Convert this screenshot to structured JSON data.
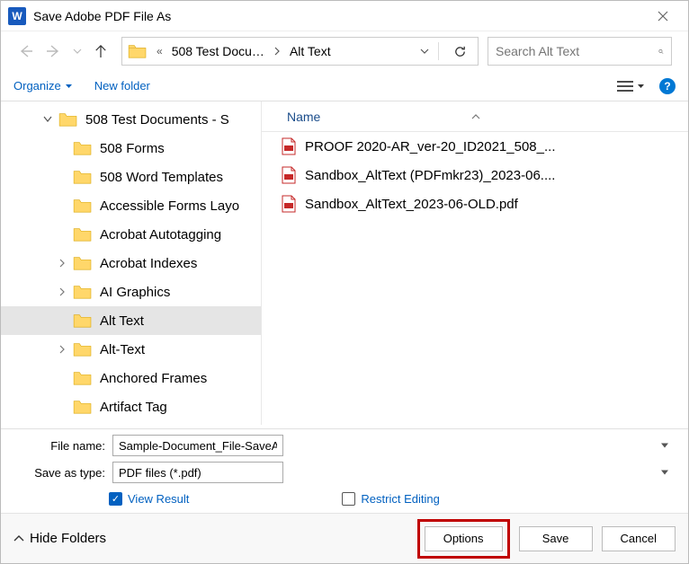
{
  "titlebar": {
    "title": "Save Adobe PDF File As"
  },
  "path": {
    "p1_prefix": "«",
    "p1": "508 Test Docu…",
    "p2": "Alt Text"
  },
  "search": {
    "placeholder": "Search Alt Text"
  },
  "toolbar": {
    "organize": "Organize",
    "newfolder": "New folder"
  },
  "tree": {
    "nodes": [
      {
        "label": "508 Test Documents - S",
        "toggle": "open",
        "depth": 0
      },
      {
        "label": "508 Forms",
        "toggle": "",
        "depth": 1
      },
      {
        "label": "508 Word Templates",
        "toggle": "",
        "depth": 1
      },
      {
        "label": "Accessible Forms Layo",
        "toggle": "",
        "depth": 1
      },
      {
        "label": "Acrobat Autotagging",
        "toggle": "",
        "depth": 1
      },
      {
        "label": "Acrobat Indexes",
        "toggle": "closed",
        "depth": 1
      },
      {
        "label": "AI Graphics",
        "toggle": "closed",
        "depth": 1
      },
      {
        "label": "Alt Text",
        "toggle": "",
        "depth": 1,
        "selected": true
      },
      {
        "label": "Alt-Text",
        "toggle": "closed",
        "depth": 1
      },
      {
        "label": "Anchored Frames",
        "toggle": "",
        "depth": 1
      },
      {
        "label": "Artifact Tag",
        "toggle": "",
        "depth": 1
      }
    ]
  },
  "list": {
    "header_name": "Name",
    "files": [
      "PROOF 2020-AR_ver-20_ID2021_508_...",
      "Sandbox_AltText (PDFmkr23)_2023-06....",
      "Sandbox_AltText_2023-06-OLD.pdf"
    ]
  },
  "fields": {
    "filename_label": "File name:",
    "filename_value": "Sample-Document_File-SaveAs.pdf",
    "type_label": "Save as type:",
    "type_value": "PDF files (*.pdf)"
  },
  "checks": {
    "view_result": "View Result",
    "restrict_editing": "Restrict Editing"
  },
  "footer": {
    "hide_folders": "Hide Folders",
    "options": "Options",
    "save": "Save",
    "cancel": "Cancel"
  }
}
